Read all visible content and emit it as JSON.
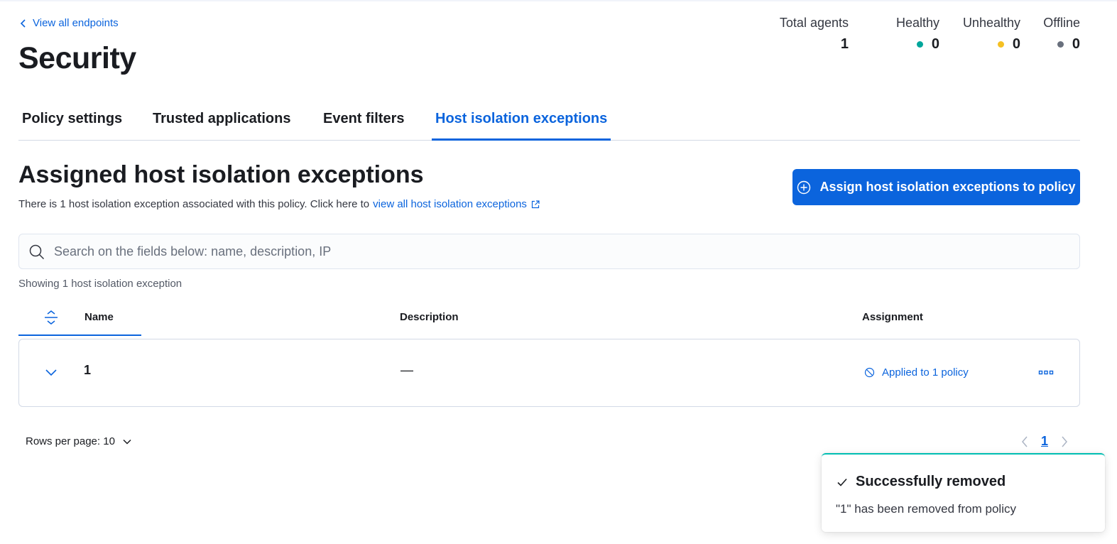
{
  "back_link": {
    "label": "View all endpoints"
  },
  "page_title": "Security",
  "stats": {
    "total_agents": {
      "label": "Total agents",
      "value": "1"
    },
    "healthy": {
      "label": "Healthy",
      "value": "0",
      "color": "#00a69b"
    },
    "unhealthy": {
      "label": "Unhealthy",
      "value": "0",
      "color": "#f5c023"
    },
    "offline": {
      "label": "Offline",
      "value": "0",
      "color": "#69707d"
    }
  },
  "tabs": [
    {
      "label": "Policy settings",
      "selected": false
    },
    {
      "label": "Trusted applications",
      "selected": false
    },
    {
      "label": "Event filters",
      "selected": false
    },
    {
      "label": "Host isolation exceptions",
      "selected": true
    }
  ],
  "section": {
    "title": "Assigned host isolation exceptions",
    "description": "There is 1 host isolation exception associated with this policy. Click here to",
    "link_label": "view all host isolation exceptions"
  },
  "assign_button": {
    "label": "Assign host isolation exceptions to policy",
    "icon": "plus-in-circle-icon"
  },
  "search": {
    "placeholder": "Search on the fields below: name, description, IP",
    "value": ""
  },
  "showing_text": "Showing 1 host isolation exception",
  "table": {
    "columns": {
      "name": "Name",
      "description": "Description",
      "assignment": "Assignment"
    },
    "rows": [
      {
        "name": "1",
        "description": "—",
        "assignment": "Applied to 1 policy"
      }
    ]
  },
  "pagination": {
    "rows_per_page": "Rows per page: 10",
    "current_page": "1"
  },
  "toast": {
    "title": "Successfully removed",
    "body": "\"1\" has been removed from policy",
    "accent_color": "#00bfb3"
  },
  "colors": {
    "primary": "#0b64dd",
    "text": "#1a1c21",
    "border": "#d3dae6"
  }
}
